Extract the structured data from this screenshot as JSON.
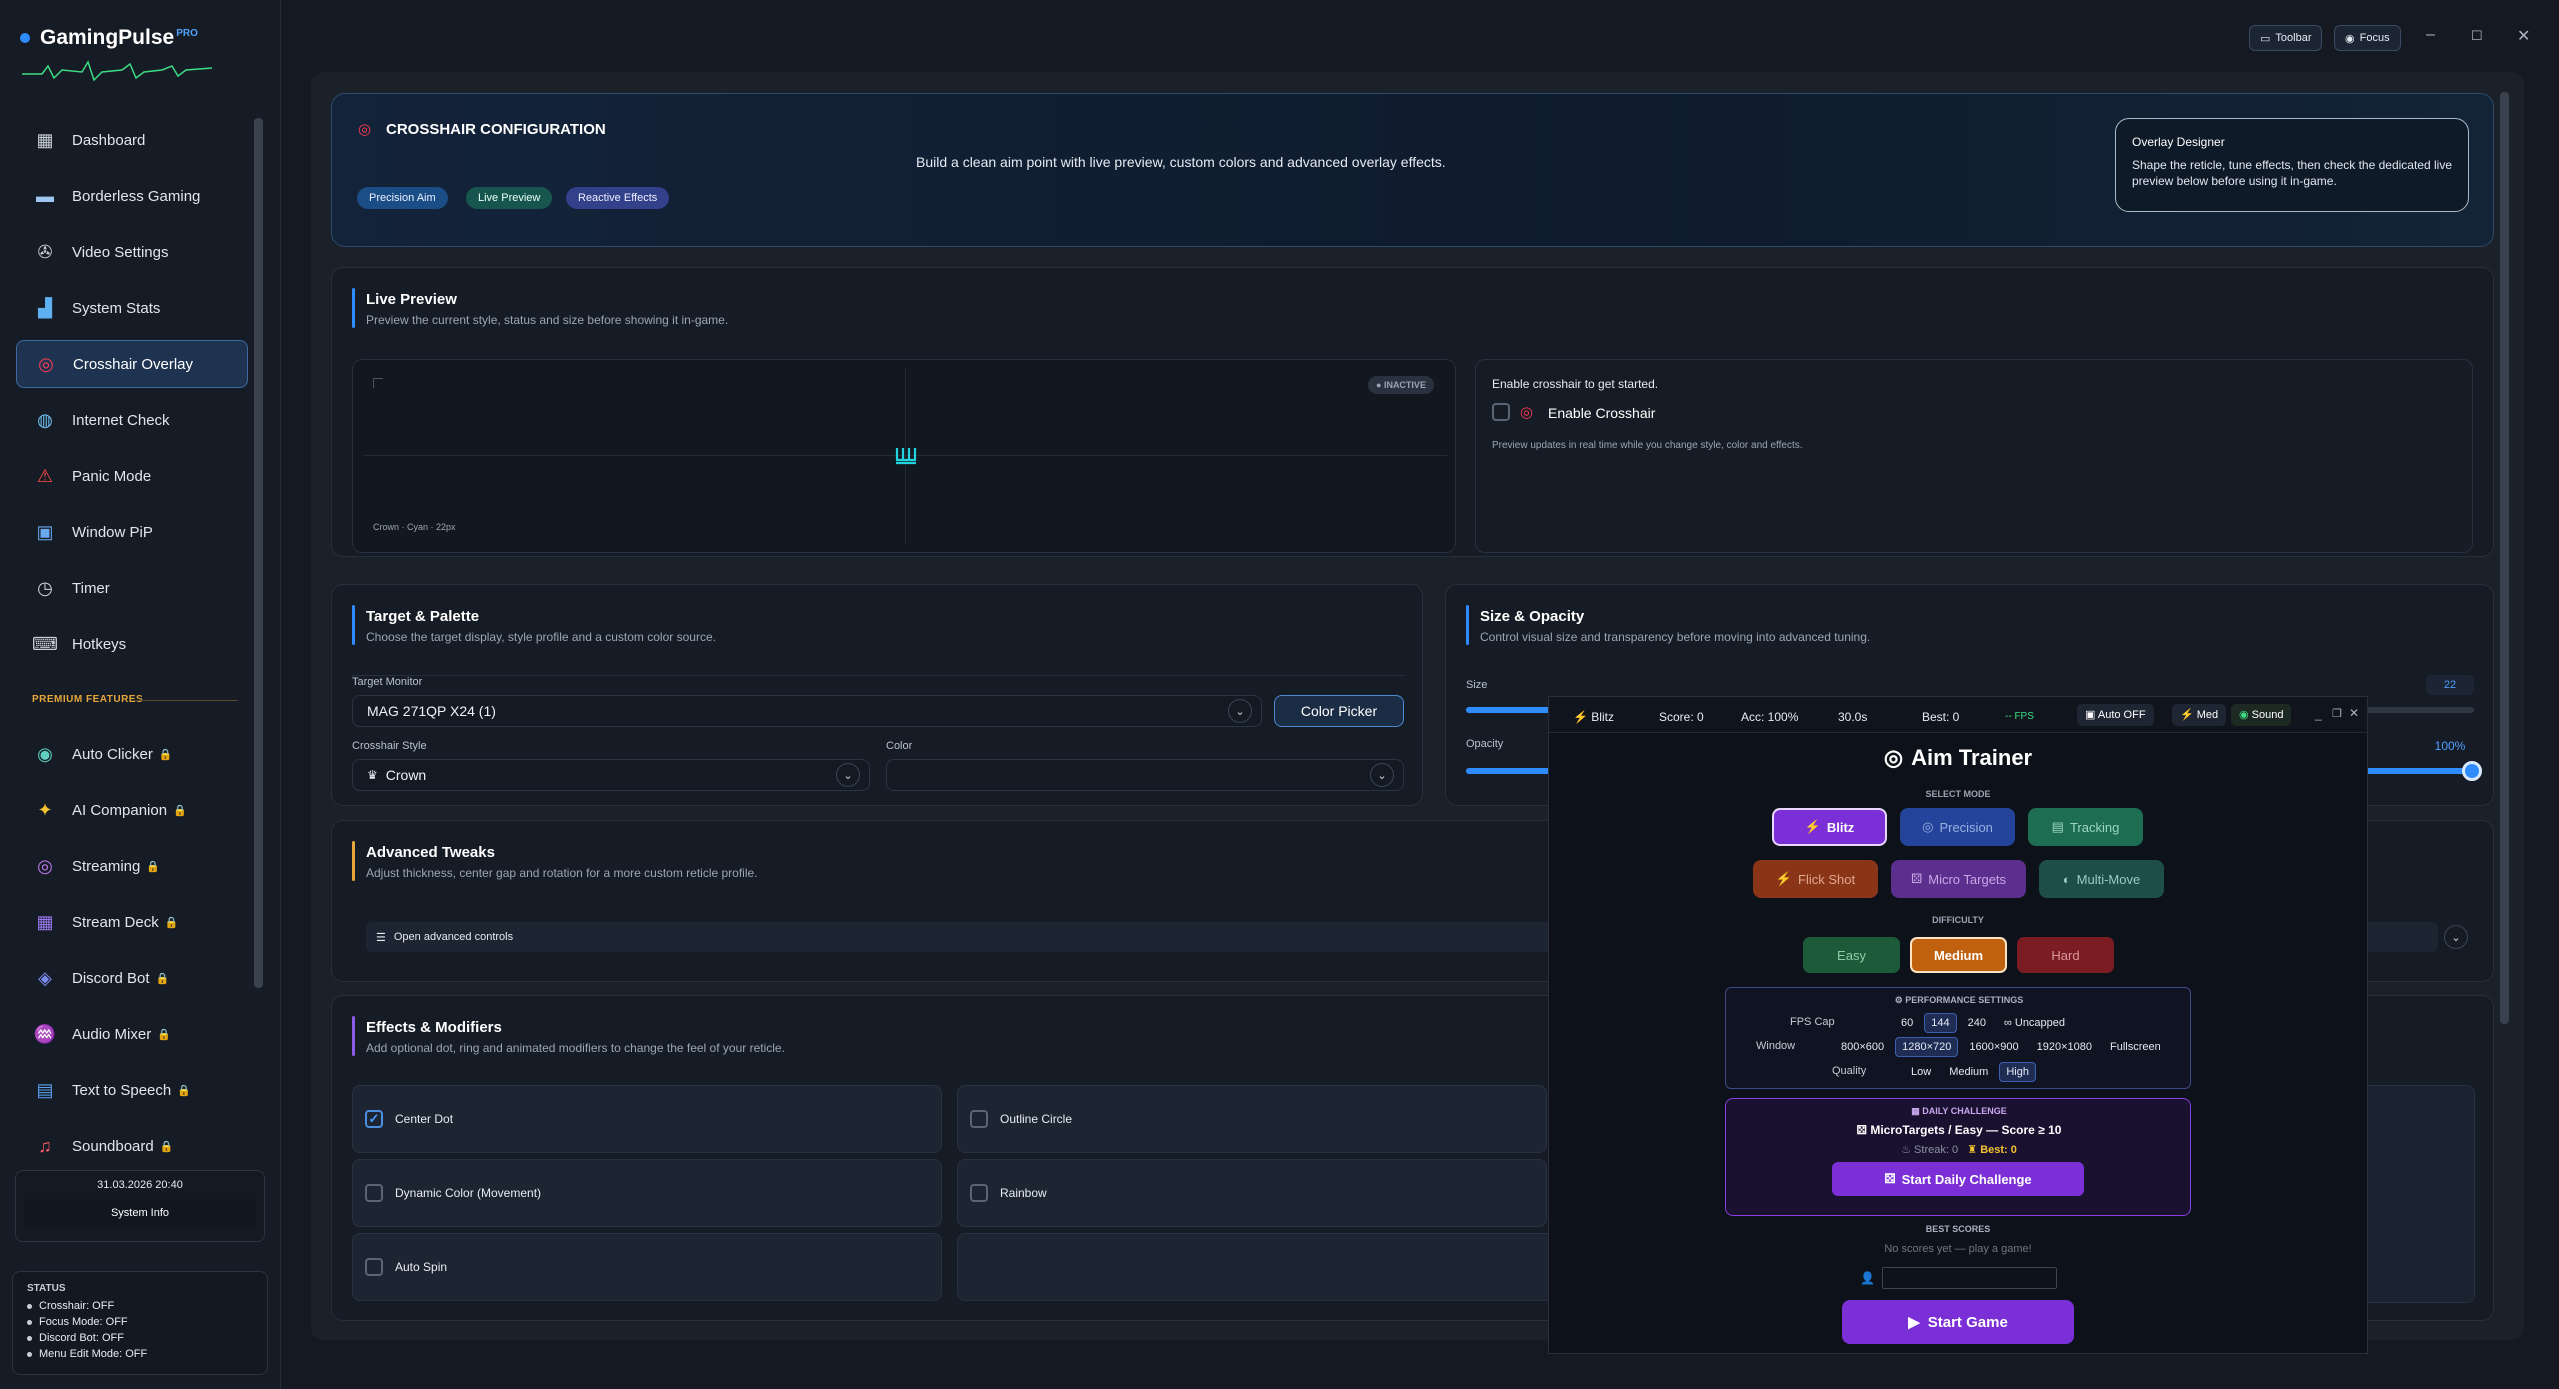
{
  "app": {
    "name": "GamingPulse",
    "badge": "PRO"
  },
  "sidebar": {
    "items": [
      {
        "label": "Dashboard",
        "icon": "dashboard-icon"
      },
      {
        "label": "Borderless Gaming",
        "icon": "monitor-icon"
      },
      {
        "label": "Video Settings",
        "icon": "film-reel-icon"
      },
      {
        "label": "System Stats",
        "icon": "bar-chart-icon"
      },
      {
        "label": "Crosshair Overlay",
        "icon": "crosshair-icon",
        "active": true
      },
      {
        "label": "Internet Check",
        "icon": "globe-icon"
      },
      {
        "label": "Panic Mode",
        "icon": "siren-icon"
      },
      {
        "label": "Window PiP",
        "icon": "pip-window-icon"
      },
      {
        "label": "Timer",
        "icon": "stopwatch-icon"
      },
      {
        "label": "Hotkeys",
        "icon": "keyboard-icon"
      }
    ],
    "premium_label": "PREMIUM FEATURES",
    "premium_items": [
      {
        "label": "Auto Clicker",
        "icon": "mouse-icon"
      },
      {
        "label": "AI Companion",
        "icon": "sparkle-icon"
      },
      {
        "label": "Streaming",
        "icon": "broadcast-icon"
      },
      {
        "label": "Stream Deck",
        "icon": "grid-icon"
      },
      {
        "label": "Discord Bot",
        "icon": "discord-icon"
      },
      {
        "label": "Audio Mixer",
        "icon": "audio-mixer-icon"
      },
      {
        "label": "Text to Speech",
        "icon": "speech-icon"
      },
      {
        "label": "Soundboard",
        "icon": "music-note-icon"
      }
    ],
    "datetime": "31.03.2026 20:40",
    "system_info": "System Info",
    "status": {
      "title": "STATUS",
      "lines": [
        "Crosshair: OFF",
        "Focus Mode: OFF",
        "Discord Bot: OFF",
        "Menu Edit Mode: OFF"
      ]
    }
  },
  "topbar": {
    "toolbar": "Toolbar",
    "focus": "Focus"
  },
  "header": {
    "title": "CROSSHAIR CONFIGURATION",
    "subtitle": "Build a clean aim point with live preview, custom colors and advanced overlay effects.",
    "tags": [
      "Precision Aim",
      "Live Preview",
      "Reactive Effects"
    ],
    "designer": {
      "title": "Overlay Designer",
      "text": "Shape the reticle, tune effects, then check the dedicated live preview below before using it in-game."
    }
  },
  "preview": {
    "title": "Live Preview",
    "subtitle": "Preview the current style, status and size before showing it in-game.",
    "status_badge": "INACTIVE",
    "caption": "Crown · Cyan · 22px",
    "hint": "Enable crosshair to get started.",
    "enable_label": "Enable Crosshair",
    "note": "Preview updates in real time while you change style, color and effects."
  },
  "palette": {
    "title": "Target & Palette",
    "subtitle": "Choose the target display, style profile and a custom color source.",
    "monitor_label": "Target Monitor",
    "monitor_value": "MAG 271QP X24 (1)",
    "color_picker": "Color Picker",
    "style_label": "Crosshair Style",
    "style_value": "Crown",
    "color_label": "Color",
    "color_value": ""
  },
  "size": {
    "title": "Size & Opacity",
    "subtitle": "Control visual size and transparency before moving into advanced tuning.",
    "size_label": "Size",
    "size_value": "22",
    "opacity_label": "Opacity",
    "opacity_value": "100%"
  },
  "tweaks": {
    "title": "Advanced Tweaks",
    "subtitle": "Adjust thickness, center gap and rotation for a more custom reticle profile.",
    "open_label": "Open advanced controls"
  },
  "effects": {
    "title": "Effects & Modifiers",
    "subtitle": "Add optional dot, ring and animated modifiers to change the feel of your reticle.",
    "items": [
      {
        "label": "Center Dot",
        "checked": true
      },
      {
        "label": "Outline Circle",
        "checked": false
      },
      {
        "label": "Dynamic Color (Movement)",
        "checked": false
      },
      {
        "label": "Rainbow",
        "checked": false
      },
      {
        "label": "Auto Spin",
        "checked": false
      }
    ]
  },
  "aim": {
    "topbar": {
      "mode": "Blitz",
      "score": "Score: 0",
      "acc": "Acc: 100%",
      "time": "30.0s",
      "best": "Best: 0",
      "fps": "-- FPS",
      "auto": "Auto OFF",
      "med": "Med",
      "sound": "Sound"
    },
    "title": "Aim Trainer",
    "select_mode": "SELECT MODE",
    "modes": [
      "Blitz",
      "Precision",
      "Tracking",
      "Flick Shot",
      "Micro Targets",
      "Multi-Move"
    ],
    "difficulty_label": "DIFFICULTY",
    "difficulties": [
      "Easy",
      "Medium",
      "Hard"
    ],
    "perf": {
      "title": "PERFORMANCE SETTINGS",
      "fps_label": "FPS Cap",
      "fps": [
        "60",
        "144",
        "240",
        "Uncapped"
      ],
      "window_label": "Window",
      "windows": [
        "800×600",
        "1280×720",
        "1600×900",
        "1920×1080",
        "Fullscreen"
      ],
      "quality_label": "Quality",
      "qualities": [
        "Low",
        "Medium",
        "High"
      ]
    },
    "daily": {
      "title": "DAILY CHALLENGE",
      "text": "MicroTargets / Easy — Score ≥ 10",
      "streak": "Streak: 0",
      "best": "Best: 0",
      "button": "Start Daily Challenge"
    },
    "best_scores_label": "BEST SCORES",
    "no_scores": "No scores yet — play a game!",
    "name_placeholder": "",
    "start": "Start Game"
  },
  "colors": {
    "accent": "#2f8cff",
    "active_nav": "#1e3350",
    "aim_purple": "#7b2fd6"
  }
}
